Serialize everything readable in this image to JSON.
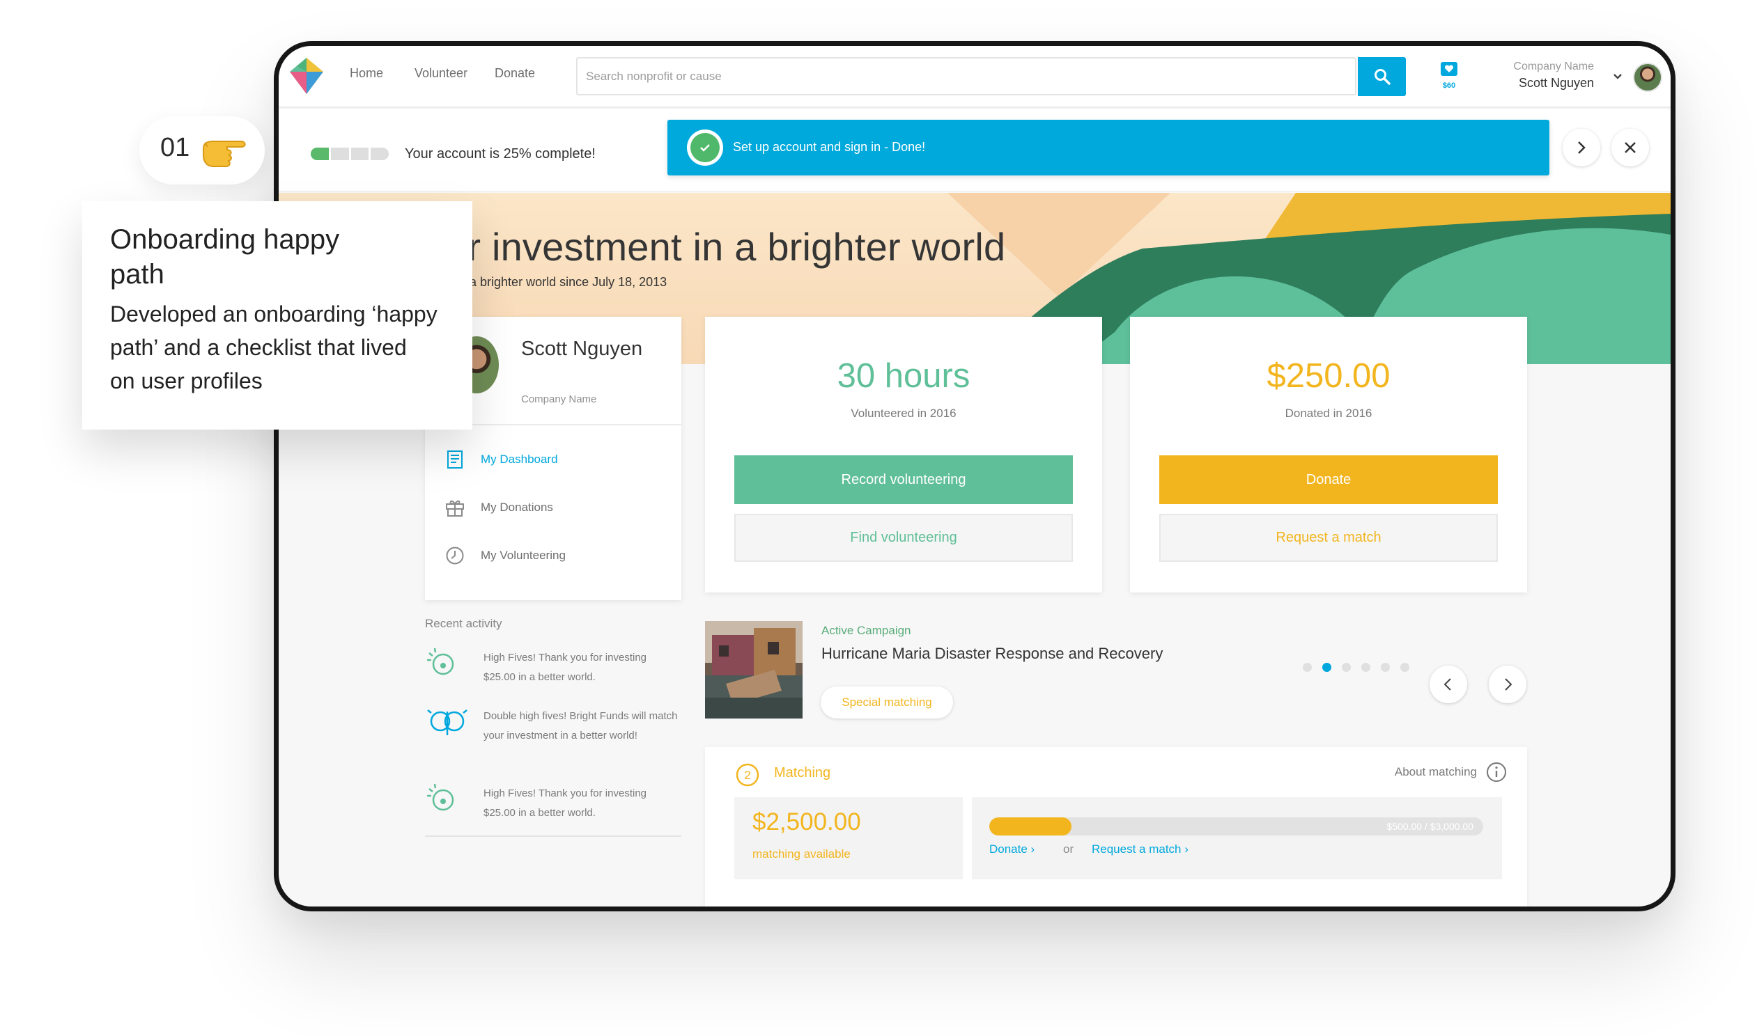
{
  "nav": {
    "home": "Home",
    "volunteer": "Volunteer",
    "donate": "Donate",
    "search_placeholder": "Search nonprofit or cause",
    "wallet_amount": "$60",
    "company": "Company Name",
    "user": "Scott Nguyen"
  },
  "progress": {
    "percent_complete": 25,
    "text": "Your account is 25% complete!",
    "banner": "Set up account and sign in - Done!"
  },
  "hero": {
    "title": "ur investment in a brighter world",
    "subtitle": "g in a brighter world since July 18, 2013"
  },
  "profile": {
    "name": "Scott Nguyen",
    "company": "Company Name",
    "menu": [
      {
        "label": "My Dashboard",
        "icon": "document-icon"
      },
      {
        "label": "My Donations",
        "icon": "gift-icon"
      },
      {
        "label": "My Volunteering",
        "icon": "clock-icon"
      }
    ]
  },
  "recent": {
    "label": "Recent activity",
    "items": [
      "High Fives! Thank you for investing $25.00 in a better world.",
      "Double high fives! Bright Funds will match your investment in a better world!",
      "High Fives! Thank you for investing $25.00 in a better world."
    ]
  },
  "volunteer_card": {
    "value": "30 hours",
    "caption": "Volunteered in 2016",
    "primary": "Record volunteering",
    "secondary": "Find volunteering"
  },
  "donation_card": {
    "value": "$250.00",
    "caption": "Donated in 2016",
    "primary": "Donate",
    "secondary": "Request a match"
  },
  "campaign": {
    "kicker": "Active Campaign",
    "title": "Hurricane Maria Disaster Response and Recovery",
    "badge": "Special matching",
    "slide_count": 6,
    "active_slide": 2
  },
  "matching": {
    "step": "2",
    "title": "Matching",
    "about": "About matching",
    "amount": "$2,500.00",
    "available": "matching available",
    "bar_label": "$500.00 / $3,000.00",
    "fill_fraction": 0.167,
    "donate_link": "Donate ›",
    "or": "or",
    "request_link": "Request a match ›"
  },
  "annotation": {
    "step": "01",
    "title": "Onboarding happy path",
    "body": "Developed an onboarding ‘happy path’ and a checklist that lived on user profiles"
  },
  "colors": {
    "brand_blue": "#00a8dd",
    "green": "#5fbf98",
    "yellow": "#f2b51e",
    "progress_green": "#5bb96b"
  }
}
